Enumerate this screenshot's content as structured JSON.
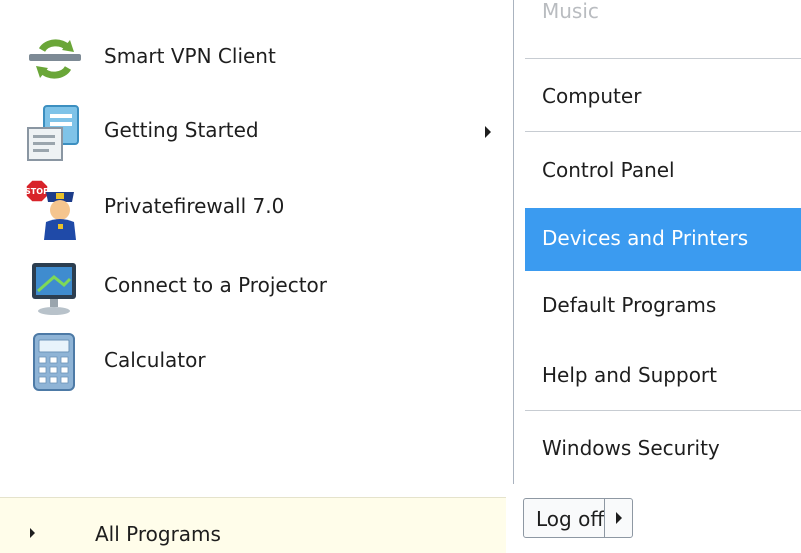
{
  "programs": [
    {
      "label": "Smart VPN Client",
      "icon": "vpn-client-icon"
    },
    {
      "label": "Getting Started",
      "icon": "getting-started-icon",
      "has_submenu": true
    },
    {
      "label": "Privatefirewall 7.0",
      "icon": "firewall-police-icon"
    },
    {
      "label": "Connect to a Projector",
      "icon": "projector-icon"
    },
    {
      "label": "Calculator",
      "icon": "calculator-icon"
    }
  ],
  "all_programs": {
    "label": "All Programs"
  },
  "right_items": [
    {
      "label": "Music"
    },
    {
      "label": "Computer"
    },
    {
      "label": "Control Panel"
    },
    {
      "label": "Devices and Printers",
      "highlighted": true
    },
    {
      "label": "Default Programs"
    },
    {
      "label": "Help and Support"
    },
    {
      "label": "Windows Security"
    }
  ],
  "logoff": {
    "label": "Log off"
  },
  "colors": {
    "highlight": "#3b9bf0",
    "all_programs_bg": "#fffdea"
  }
}
